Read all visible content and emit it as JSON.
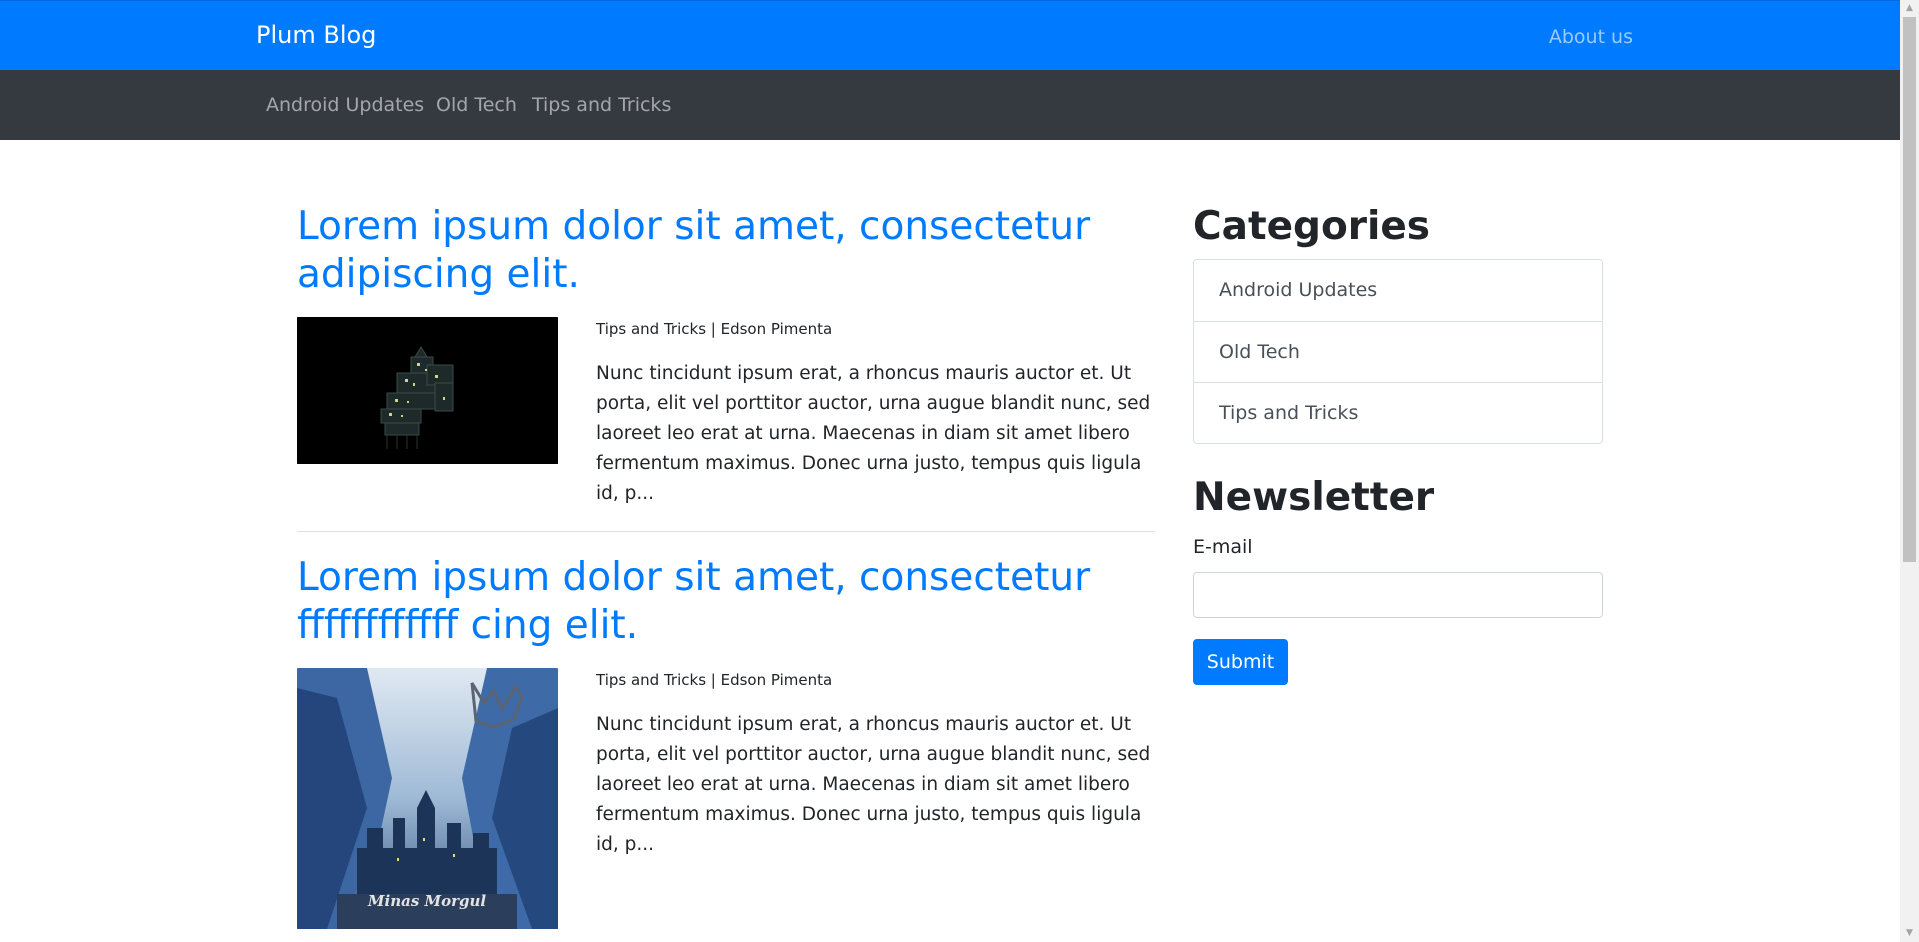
{
  "header": {
    "brand": "Plum Blog",
    "about_link": "About us"
  },
  "subnav": {
    "items": [
      {
        "label": "Android Updates"
      },
      {
        "label": "Old Tech"
      },
      {
        "label": "Tips and Tricks"
      }
    ]
  },
  "posts": [
    {
      "title_line1": "Lorem ipsum dolor sit amet, consectetur",
      "title_line2": "adipiscing elit.",
      "meta": "Tips and Tricks | Edson Pimenta",
      "excerpt": "Nunc tincidunt ipsum erat, a rhoncus mauris auctor et. Ut porta, elit vel porttitor auctor, urna augue blandit nunc, sed laoreet leo erat at urna. Maecenas in diam sit amet libero fermentum maximus. Donec urna justo, tempus quis ligula id, p..."
    },
    {
      "title_line1": "Lorem ipsum dolor sit amet, consectetur",
      "title_line2": "ffffffffffff cing elit.",
      "meta": "Tips and Tricks | Edson Pimenta",
      "excerpt": "Nunc tincidunt ipsum erat, a rhoncus mauris auctor et. Ut porta, elit vel porttitor auctor, urna augue blandit nunc, sed laoreet leo erat at urna. Maecenas in diam sit amet libero fermentum maximus. Donec urna justo, tempus quis ligula id, p...",
      "image_caption": "Minas Morgul"
    }
  ],
  "sidebar": {
    "categories_heading": "Categories",
    "categories": [
      {
        "label": "Android Updates"
      },
      {
        "label": "Old Tech"
      },
      {
        "label": "Tips and Tricks"
      }
    ],
    "newsletter_heading": "Newsletter",
    "email_label": "E-mail",
    "email_value": "",
    "submit_label": "Submit"
  },
  "colors": {
    "primary": "#007bff",
    "dark": "#343a40"
  }
}
